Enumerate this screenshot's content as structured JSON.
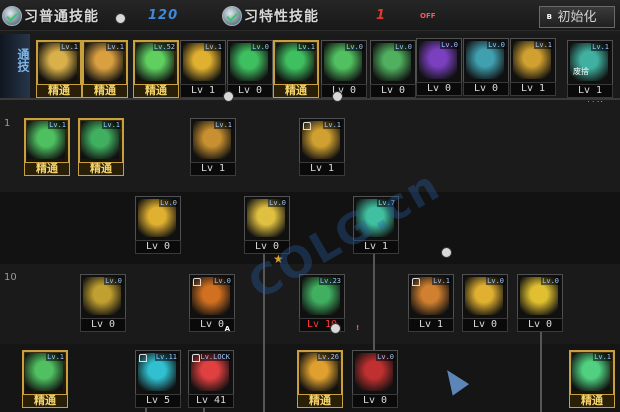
{
  "header": {
    "general_tab": {
      "label": "习普通技能",
      "count": "120",
      "count_color": "#3f8ad8"
    },
    "special_tab": {
      "label": "习特性技能",
      "count": "1",
      "count_color": "#e03a2a"
    },
    "reset_label": "初始化"
  },
  "equip_bar": {
    "side_label": "通技",
    "slots": [
      {
        "name": "equip-slot-1",
        "icon": "figure-run-icon",
        "color": "#d9b04a",
        "mastered": true,
        "level": "精通",
        "mini": "Lv.1"
      },
      {
        "name": "equip-slot-2",
        "icon": "fist-icon",
        "color": "#d9a040",
        "mastered": true,
        "level": "精通",
        "mini": "Lv.1",
        "clock": true
      },
      {
        "name": "equip-slot-3",
        "icon": "kick-icon",
        "color": "#5fd060",
        "mastered": true,
        "level": "精通",
        "mini": "Lv.52"
      },
      {
        "name": "equip-slot-4",
        "icon": "wing-icon",
        "color": "#e0b030",
        "level": "Lv 1",
        "mini": "Lv.1"
      },
      {
        "name": "equip-slot-5",
        "icon": "crosshair-icon",
        "color": "#3fc060",
        "level": "Lv 0",
        "mini": "Lv.0"
      },
      {
        "name": "equip-slot-6",
        "icon": "crosshair-icon",
        "color": "#3fc060",
        "mastered": true,
        "level": "精通",
        "mini": "Lv.1"
      },
      {
        "name": "equip-slot-7",
        "icon": "figure-icon",
        "color": "#50c060",
        "level": "Lv 0",
        "mini": "Lv.0"
      },
      {
        "name": "equip-slot-8",
        "icon": "figure-icon",
        "color": "#50b060",
        "level": "Lv 0",
        "mini": "Lv.0"
      },
      {
        "name": "equip-slot-9",
        "icon": "aura-off-icon",
        "color": "#7a40c0",
        "level": "Lv 0",
        "mini": "Lv.0",
        "badge": "OFF"
      },
      {
        "name": "equip-slot-10",
        "icon": "strike-icon",
        "color": "#40a0b0",
        "level": "Lv 0",
        "mini": "Lv.0"
      },
      {
        "name": "equip-slot-11",
        "icon": "claw-icon",
        "color": "#d0a030",
        "level": "Lv 1",
        "mini": "Lv.1",
        "corner": "B"
      },
      {
        "name": "equip-slot-12",
        "icon": "swap-skill-icon",
        "color": "#40b0a0",
        "level": "Lv 1",
        "mini": "Lv.1",
        "swap": "⟳转换",
        "sub": "废捨"
      }
    ]
  },
  "tree": {
    "row_numbers": [
      "1",
      "10"
    ],
    "slots": [
      {
        "name": "tree-skill-a1",
        "icon": "meditate-icon",
        "color": "#4fc060",
        "mastered": true,
        "level": "精通",
        "mini": "Lv.1"
      },
      {
        "name": "tree-skill-a2",
        "icon": "sword-icon",
        "color": "#40b060",
        "mastered": true,
        "level": "精通",
        "mini": "Lv.1"
      },
      {
        "name": "tree-skill-a3",
        "icon": "glove-icon",
        "color": "#c89030",
        "level": "Lv 1",
        "mini": "Lv.1",
        "clock": true
      },
      {
        "name": "tree-skill-a4",
        "icon": "punch-icon",
        "color": "#d0a030",
        "level": "Lv 1",
        "mini": "Lv.1",
        "clock": true,
        "lock": true
      },
      {
        "name": "tree-skill-b1",
        "icon": "leap-icon",
        "color": "#e0b030",
        "level": "Lv 0",
        "mini": "Lv.0"
      },
      {
        "name": "tree-skill-b2",
        "icon": "body-icon",
        "color": "#e0c040",
        "level": "Lv 0",
        "mini": "Lv.0"
      },
      {
        "name": "tree-skill-b3",
        "icon": "slam-icon",
        "color": "#40c0a0",
        "level": "Lv 1",
        "mini": "Lv.7"
      },
      {
        "name": "tree-skill-c1",
        "icon": "burst-icon",
        "color": "#c0a030",
        "level": "Lv 0",
        "mini": "Lv.0"
      },
      {
        "name": "tree-skill-c2",
        "icon": "twist-icon",
        "color": "#d07020",
        "level": "Lv 0",
        "mini": "Lv.0",
        "lock": true
      },
      {
        "name": "tree-skill-c3",
        "icon": "muscle-icon",
        "color": "#40b060",
        "level": "Lv 10",
        "mini": "Lv.23",
        "red": true
      },
      {
        "name": "tree-skill-c4",
        "icon": "uppercut-icon",
        "color": "#d08030",
        "level": "Lv 1",
        "mini": "Lv.1",
        "clock": true,
        "lock": true
      },
      {
        "name": "tree-skill-c5",
        "icon": "hook-icon",
        "color": "#e0b030",
        "level": "Lv 0",
        "mini": "Lv.0"
      },
      {
        "name": "tree-skill-c6",
        "icon": "sweep-icon",
        "color": "#e0c030",
        "level": "Lv 0",
        "mini": "Lv.0"
      },
      {
        "name": "tree-skill-d1",
        "icon": "stance-icon",
        "color": "#50c060",
        "mastered": true,
        "level": "精通",
        "mini": "Lv.1"
      },
      {
        "name": "tree-skill-d2",
        "icon": "dash-icon",
        "color": "#30c0d0",
        "level": "Lv 5",
        "mini": "Lv.11",
        "lock": true
      },
      {
        "name": "tree-skill-d3",
        "icon": "search-icon",
        "color": "#e04040",
        "level": "Lv 41",
        "mini": "Lv.LOCK",
        "lock": true,
        "corner": "A"
      },
      {
        "name": "tree-skill-d4",
        "icon": "explode-icon",
        "color": "#e0a030",
        "mastered": true,
        "level": "精通",
        "mini": "Lv.26",
        "clock": true
      },
      {
        "name": "tree-skill-d5",
        "icon": "shatter-icon",
        "color": "#c03030",
        "level": "Lv 0",
        "mini": "Lv.0",
        "badge": "!"
      },
      {
        "name": "tree-skill-d6",
        "icon": "spark-icon",
        "color": "#50d080",
        "mastered": true,
        "level": "精通",
        "mini": "Lv.1"
      }
    ]
  },
  "watermark": "COLG.cn"
}
